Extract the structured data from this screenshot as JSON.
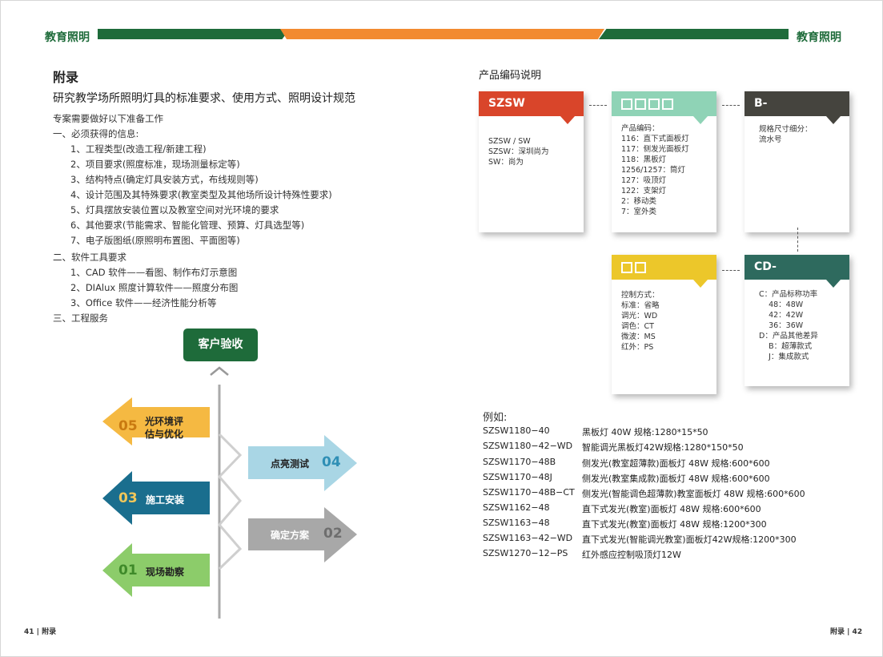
{
  "header": {
    "left_title": "教育照明",
    "right_title": "教育照明"
  },
  "colors": {
    "green": "#1e6b3a",
    "orange": "#f28a30"
  },
  "left": {
    "heading": "附录",
    "subtitle": "研究教学场所照明灯具的标准要求、使用方式、照明设计规范",
    "lines": [
      "专案需要做好以下准备工作",
      "一、必须获得的信息:",
      "1、工程类型(改造工程/新建工程)",
      "2、项目要求(照度标准，现场测量标定等)",
      "3、结构特点(确定灯具安装方式，布线规则等)",
      "4、设计范围及其特殊要求(教室类型及其他场所设计特殊性要求)",
      "5、灯具摆放安装位置以及教室空间对光环境的要求",
      "6、其他要求(节能需求、智能化管理、预算、灯具选型等)",
      "7、电子版图纸(原照明布置图、平面图等)",
      "二、软件工具要求",
      "1、CAD 软件——看图、制作布灯示意图",
      "2、DIAlux 照度计算软件——照度分布图",
      "3、Office 软件——经济性能分析等",
      "三、工程服务"
    ]
  },
  "flow": {
    "top": "客户验收",
    "steps": [
      {
        "num": "05",
        "label1": "光环境评",
        "label2": "估与优化",
        "color": "#f5b942",
        "numcolor": "#c97a10"
      },
      {
        "num": "04",
        "label1": "点亮测试",
        "label2": "",
        "color": "#a9d6e5",
        "numcolor": "#2f8fb5"
      },
      {
        "num": "03",
        "label1": "施工安装",
        "label2": "",
        "color": "#1a6e8e",
        "numcolor": "#f0c75a"
      },
      {
        "num": "02",
        "label1": "确定方案",
        "label2": "",
        "color": "#a8a8a8",
        "numcolor": "#6e6e6e"
      },
      {
        "num": "01",
        "label1": "现场勘察",
        "label2": "",
        "color": "#8ccc6a",
        "numcolor": "#3f8a2a"
      }
    ]
  },
  "right": {
    "title": "产品编码说明",
    "cards": [
      {
        "head": "SZSW",
        "color": "#d9452a",
        "body": "SZSW / SW\nSZSW：深圳尚为\nSW：尚为"
      },
      {
        "head": "□□□□",
        "color": "#8fd3b6",
        "body": "产品编码：\n116：直下式面板灯\n117：侧发光面板灯\n118：黑板灯\n1256/1257：筒灯\n127：吸顶灯\n122：支架灯\n2：移动类\n7：室外类"
      },
      {
        "head": "B-",
        "color": "#45443e",
        "body": "规格尺寸细分：\n流水号"
      },
      {
        "head": "□□",
        "color": "#ecc72a",
        "body": "控制方式：\n标准：省略\n调光：WD\n调色：CT\n微波：MS\n红外：PS"
      },
      {
        "head": "CD-",
        "color": "#2e6a5e",
        "body": "C：产品标称功率\n    48：48W\n    42：42W\n    36：36W\nD：产品其他差异\n    B：超薄款式\n    J：集成款式"
      }
    ],
    "example_title": "例如:",
    "examples": [
      {
        "code": "SZSW1180−40",
        "desc": "黑板灯 40W 规格:1280*15*50"
      },
      {
        "code": "SZSW1180−42−WD",
        "desc": "智能调光黑板灯42W规格:1280*150*50"
      },
      {
        "code": "SZSW1170−48B",
        "desc": "侧发光(教室超薄款)面板灯 48W 规格:600*600"
      },
      {
        "code": "SZSW1170−48J",
        "desc": "侧发光(教室集成款)面板灯 48W 规格:600*600"
      },
      {
        "code": "SZSW1170−48B−CT",
        "desc": "侧发光(智能调色超薄款)教室面板灯 48W 规格:600*600"
      },
      {
        "code": "SZSW1162−48",
        "desc": "直下式发光(教室)面板灯 48W 规格:600*600"
      },
      {
        "code": "SZSW1163−48",
        "desc": "直下式发光(教室)面板灯 48W 规格:1200*300"
      },
      {
        "code": "SZSW1163−42−WD",
        "desc": "直下式发光(智能调光教室)面板灯42W规格:1200*300"
      },
      {
        "code": "SZSW1270−12−PS",
        "desc": "红外感应控制吸顶灯12W"
      }
    ]
  },
  "footer": {
    "left": "41 | 附录",
    "right": "附录 | 42"
  }
}
